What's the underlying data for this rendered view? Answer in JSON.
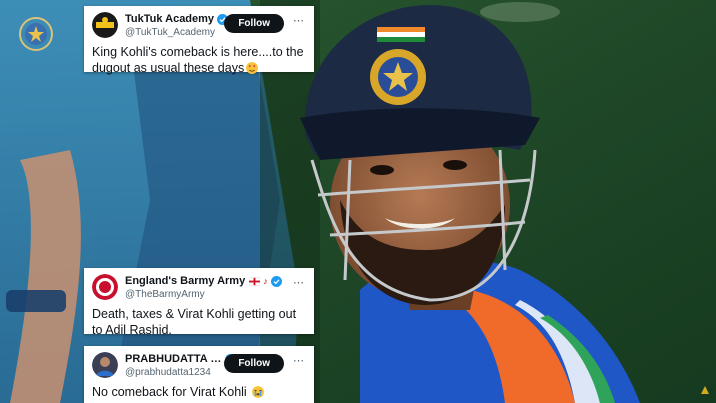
{
  "tweets": [
    {
      "display_name": "TukTuk Academy",
      "handle": "@TukTuk_Academy",
      "follow_label": "Follow",
      "text": "King Kohli's comeback is here....to the dugout as usual these days"
    },
    {
      "display_name": "England's Barmy Army",
      "handle": "@TheBarmyArmy",
      "text": "Death, taxes & Virat Kohli getting out to Adil Rashid."
    },
    {
      "display_name": "PRABHUDATTA MA...",
      "handle": "@prabhudatta1234",
      "follow_label": "Follow",
      "text": "No comeback for Virat Kohli"
    }
  ],
  "colors": {
    "verified": "#1d9bf0",
    "follow_bg": "#0f1419",
    "helmet": "#1c2a44",
    "jersey_blue": "#1f57c7",
    "jersey_orange": "#f06a2a"
  },
  "icons": [
    "bcci-logo-icon",
    "verified-badge-icon",
    "more-options-icon",
    "heart-eyes-emoji-icon",
    "crying-emoji-icon",
    "england-flag-icon"
  ]
}
